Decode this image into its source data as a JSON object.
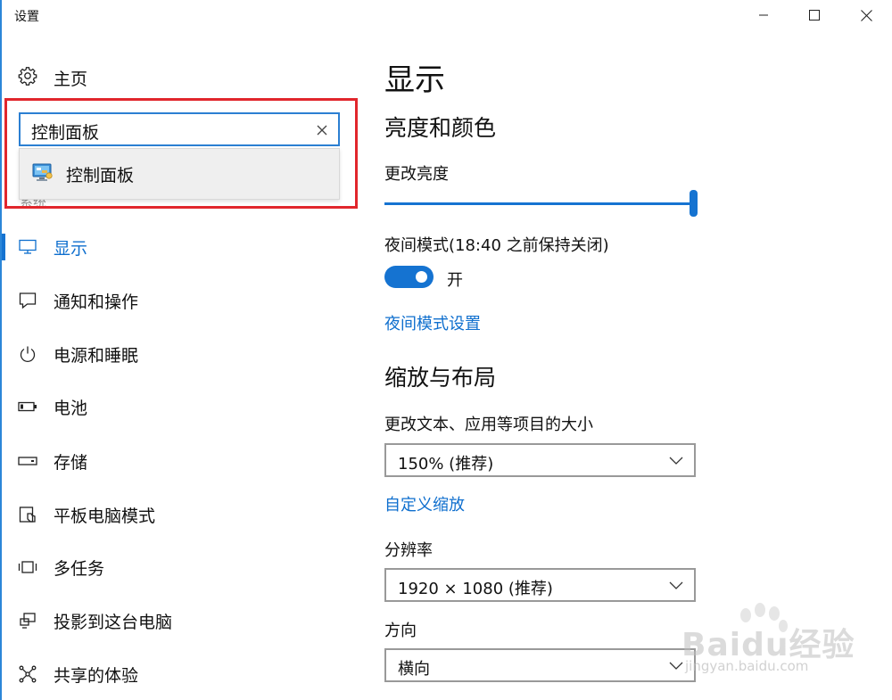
{
  "window": {
    "title": "设置",
    "controls": {
      "minimize": "minimize-icon",
      "maximize": "maximize-icon",
      "close": "close-icon"
    }
  },
  "sidebar": {
    "home_label": "主页",
    "search": {
      "value": "控制面板"
    },
    "suggestion": {
      "label": "控制面板",
      "icon": "control-panel-icon"
    },
    "peek_label": "系统",
    "items": [
      {
        "label": "显示",
        "icon": "monitor-icon",
        "active": true
      },
      {
        "label": "通知和操作",
        "icon": "notification-icon"
      },
      {
        "label": "电源和睡眠",
        "icon": "power-icon"
      },
      {
        "label": "电池",
        "icon": "battery-icon"
      },
      {
        "label": "存储",
        "icon": "storage-icon"
      },
      {
        "label": "平板电脑模式",
        "icon": "tablet-mode-icon"
      },
      {
        "label": "多任务",
        "icon": "multitask-icon"
      },
      {
        "label": "投影到这台电脑",
        "icon": "project-icon"
      },
      {
        "label": "共享的体验",
        "icon": "share-icon"
      }
    ]
  },
  "main": {
    "title": "显示",
    "brightness": {
      "section": "亮度和颜色",
      "label": "更改亮度",
      "level": 1.0
    },
    "night_light": {
      "label": "夜间模式(18:40 之前保持关闭)",
      "toggle_state": "开",
      "settings_link": "夜间模式设置"
    },
    "scale": {
      "section": "缩放与布局",
      "label": "更改文本、应用等项目的大小",
      "value": "150% (推荐)",
      "custom_link": "自定义缩放"
    },
    "resolution": {
      "label": "分辨率",
      "value": "1920 × 1080 (推荐)"
    },
    "orientation": {
      "label": "方向",
      "value": "横向"
    }
  },
  "watermark": {
    "text": "Baidu经验",
    "sub": "jingyan.baidu.com"
  },
  "colors": {
    "accent": "#1573d1",
    "highlight_frame": "#e1262c"
  }
}
